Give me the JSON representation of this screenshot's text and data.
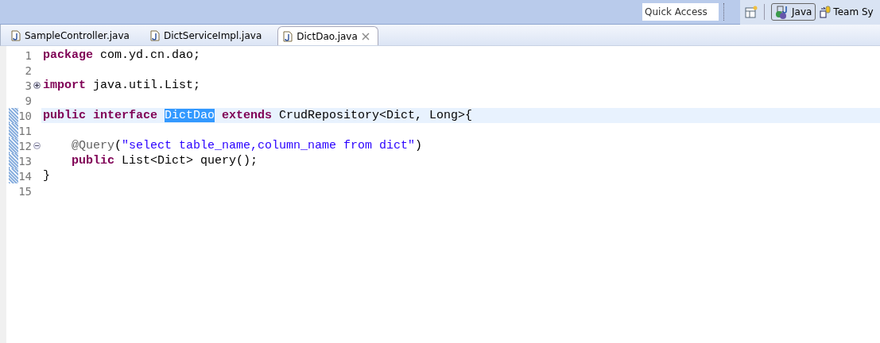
{
  "toolbar": {
    "quick_access": {
      "placeholder": "Quick Access"
    },
    "perspectives": [
      {
        "label": "Java",
        "selected": true,
        "kind": "java"
      },
      {
        "label": "Team Sy",
        "selected": false,
        "kind": "team"
      }
    ]
  },
  "tabs": [
    {
      "label": "SampleController.java",
      "selected": false
    },
    {
      "label": "DictServiceImpl.java",
      "selected": false
    },
    {
      "label": "DictDao.java",
      "selected": true
    }
  ],
  "editor": {
    "lines": [
      {
        "number": "1",
        "current": false,
        "in_range": false,
        "indented": false,
        "tokens": [
          {
            "kind": "keyword",
            "text": "package "
          },
          {
            "kind": "plain",
            "text": "com.yd.cn.dao;"
          }
        ]
      },
      {
        "number": "2",
        "current": false,
        "in_range": false
      },
      {
        "number": "3",
        "folded": true,
        "current": false,
        "in_range": false,
        "indented": false,
        "tokens": [
          {
            "kind": "keyword",
            "text": "import "
          },
          {
            "kind": "plain",
            "text": "java.util.List;"
          }
        ]
      },
      {
        "number": "9",
        "current": false,
        "in_range": false
      },
      {
        "number": "10",
        "current": true,
        "in_range": true,
        "indented": false,
        "tokens": [
          {
            "kind": "keyword",
            "text": "public interface "
          },
          {
            "kind": "selection",
            "text": "DictDao"
          },
          {
            "kind": "keyword",
            "text": " extends "
          },
          {
            "kind": "plain",
            "text": "CrudRepository<Dict, Long>{"
          }
        ]
      },
      {
        "number": "11",
        "current": false,
        "in_range": true
      },
      {
        "number": "12",
        "folded": false,
        "current": false,
        "in_range": true,
        "indented": true,
        "tokens": [
          {
            "kind": "annotation",
            "text": "@Query"
          },
          {
            "kind": "plain",
            "text": "("
          },
          {
            "kind": "string",
            "text": "\"select table_name,column_name from dict\""
          },
          {
            "kind": "plain",
            "text": ")"
          }
        ]
      },
      {
        "number": "13",
        "current": false,
        "in_range": true,
        "indented": true,
        "tokens": [
          {
            "kind": "keyword",
            "text": "public "
          },
          {
            "kind": "plain",
            "text": "List<Dict> query();"
          }
        ]
      },
      {
        "number": "14",
        "current": false,
        "in_range": true,
        "indented": false,
        "tokens": [
          {
            "kind": "plain",
            "text": "}"
          }
        ]
      },
      {
        "number": "15",
        "current": false,
        "in_range": false
      }
    ]
  }
}
